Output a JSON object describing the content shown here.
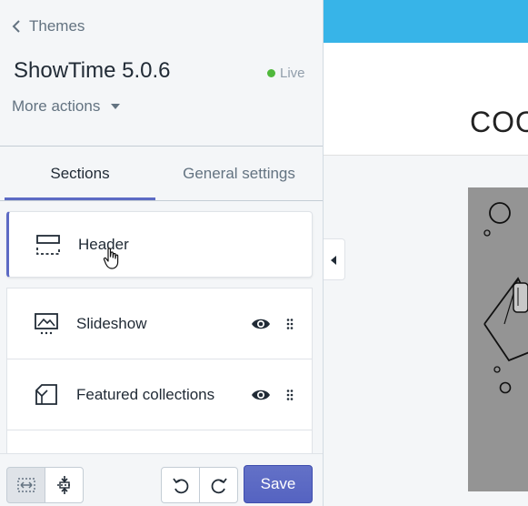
{
  "sidebar": {
    "back_label": "Themes",
    "theme_name": "ShowTime 5.0.6",
    "status": "Live",
    "more_actions": "More actions",
    "tabs": [
      {
        "label": "Sections",
        "active": true
      },
      {
        "label": "General settings",
        "active": false
      }
    ],
    "sections": [
      {
        "label": "Header",
        "icon": "header-layout-icon"
      },
      {
        "label": "Slideshow",
        "icon": "image-gallery-icon"
      },
      {
        "label": "Featured collections",
        "icon": "collection-icon"
      }
    ]
  },
  "toolbar": {
    "save_label": "Save"
  },
  "preview": {
    "logo_text": "COO"
  },
  "colors": {
    "accent": "#5c6ac4",
    "live": "#50b83c",
    "preview_bar": "#37b4e8"
  }
}
